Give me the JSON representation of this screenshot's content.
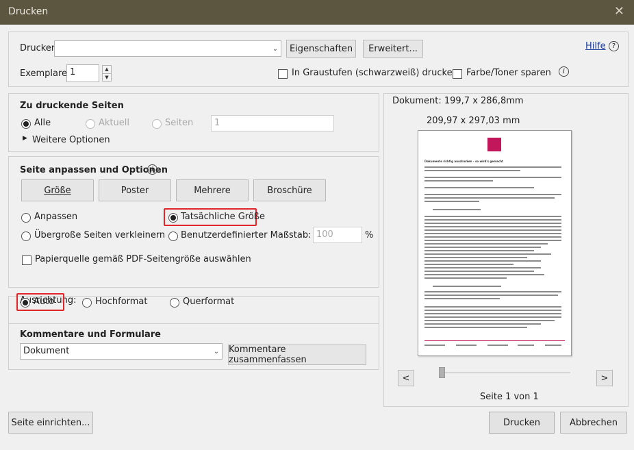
{
  "window": {
    "title": "Drucken",
    "close_glyph": "✕"
  },
  "printer": {
    "label": "Drucker:",
    "value": "",
    "properties_btn": "Eigenschaften",
    "advanced_btn": "Erweitert...",
    "help_link": "Hilfe",
    "help_icon": "?"
  },
  "copies": {
    "label": "Exemplare:",
    "value": "1",
    "grayscale_label": "In Graustufen (schwarzweiß) drucken",
    "save_toner_label": "Farbe/Toner sparen"
  },
  "pages": {
    "heading": "Zu druckende Seiten",
    "all": "Alle",
    "current": "Aktuell",
    "pages": "Seiten",
    "pages_value": "1",
    "more_options": "Weitere Optionen"
  },
  "fit": {
    "heading": "Seite anpassen und Optionen",
    "tabs": [
      "Größe",
      "Poster",
      "Mehrere",
      "Broschüre"
    ],
    "fit_label": "Anpassen",
    "actual_size_label": "Tatsächliche Größe",
    "shrink_label": "Übergroße Seiten verkleinern",
    "custom_scale_label": "Benutzerdefinierter Maßstab:",
    "scale_value": "100",
    "scale_unit": "%",
    "paper_source_label": "Papierquelle gemäß PDF-Seitengröße auswählen"
  },
  "orientation": {
    "heading": "Ausrichtung:",
    "auto": "Auto",
    "portrait": "Hochformat",
    "landscape": "Querformat"
  },
  "comments": {
    "heading": "Kommentare und Formulare",
    "value": "Dokument",
    "summarize_btn": "Kommentare zusammenfassen"
  },
  "preview": {
    "document_size": "Dokument: 199,7 x 286,8mm",
    "paper_size": "209,97 x 297,03 mm",
    "doc_heading": "Dokumente richtig ausdrucken - so wird's gemacht",
    "prev_btn": "<",
    "next_btn": ">",
    "page_info": "Seite 1 von 1",
    "slider_value": 0
  },
  "footer": {
    "page_setup_btn": "Seite einrichten...",
    "print_btn": "Drucken",
    "cancel_btn": "Abbrechen"
  },
  "colors": {
    "titlebar": "#5c5640",
    "highlight": "#e0252b",
    "logo": "#c2185b"
  }
}
